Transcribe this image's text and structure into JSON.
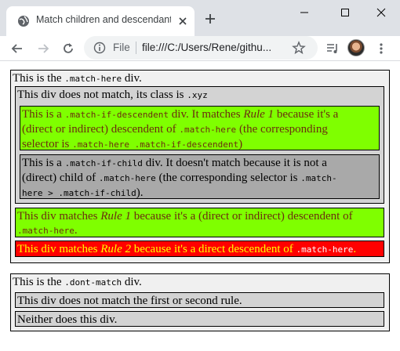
{
  "browser": {
    "tab_title": "Match children and descendants",
    "url_scheme": "File",
    "url": "file:///C:/Users/Rene/githu..."
  },
  "page": {
    "match_here": {
      "intro_pre": "This is the ",
      "intro_code": ".match-here",
      "intro_post": " div.",
      "xyz": {
        "pre": "This div does not match, its class is ",
        "code": ".xyz",
        "descendent": {
          "l1_pre": "This is a ",
          "l1_code": ".match-if-descendent",
          "l1_mid": " div. It matches ",
          "l1_em": "Rule 1",
          "l1_post": " because it's a",
          "l2_pre": "(direct or indirect) descendent of ",
          "l2_code": ".match-here",
          "l2_post": " (the corresponding",
          "l3_pre": "selector is ",
          "l3_code": ".match-here .match-if-descendent",
          "l3_post": ")"
        },
        "child": {
          "l1_pre": "This is a ",
          "l1_code": ".match-if-child",
          "l1_post": " div. It doesn't match because it is not a",
          "l2_pre": "(direct) child of ",
          "l2_code1": ".match-here",
          "l2_mid": " (the corresponding selector is ",
          "l2_code2": ".match-",
          "l3_code": "here > .match-if-child",
          "l3_post": ")."
        }
      },
      "rule1": {
        "l1_pre": "This div matches ",
        "l1_em": "Rule 1",
        "l1_post": " because it's a (direct or indirect) descendent of",
        "l2_code": ".match-here",
        "l2_post": "."
      },
      "rule2": {
        "pre": "This div matches ",
        "em": "Rule 2",
        "mid": " because it's a direct descendent of ",
        "code": ".match-here",
        "post": "."
      }
    },
    "dont_match": {
      "intro_pre": "This is the ",
      "intro_code": ".dont-match",
      "intro_post": " div.",
      "item1": "This div does not match the first or second rule.",
      "item2": "Neither does this div."
    }
  },
  "colors": {
    "green_bg": "#7fff00",
    "red_bg": "#ff0000",
    "gray_outer": "#f0f0f0",
    "gray_inner": "#d3d3d3",
    "dark_gray": "#a9a9a9"
  }
}
